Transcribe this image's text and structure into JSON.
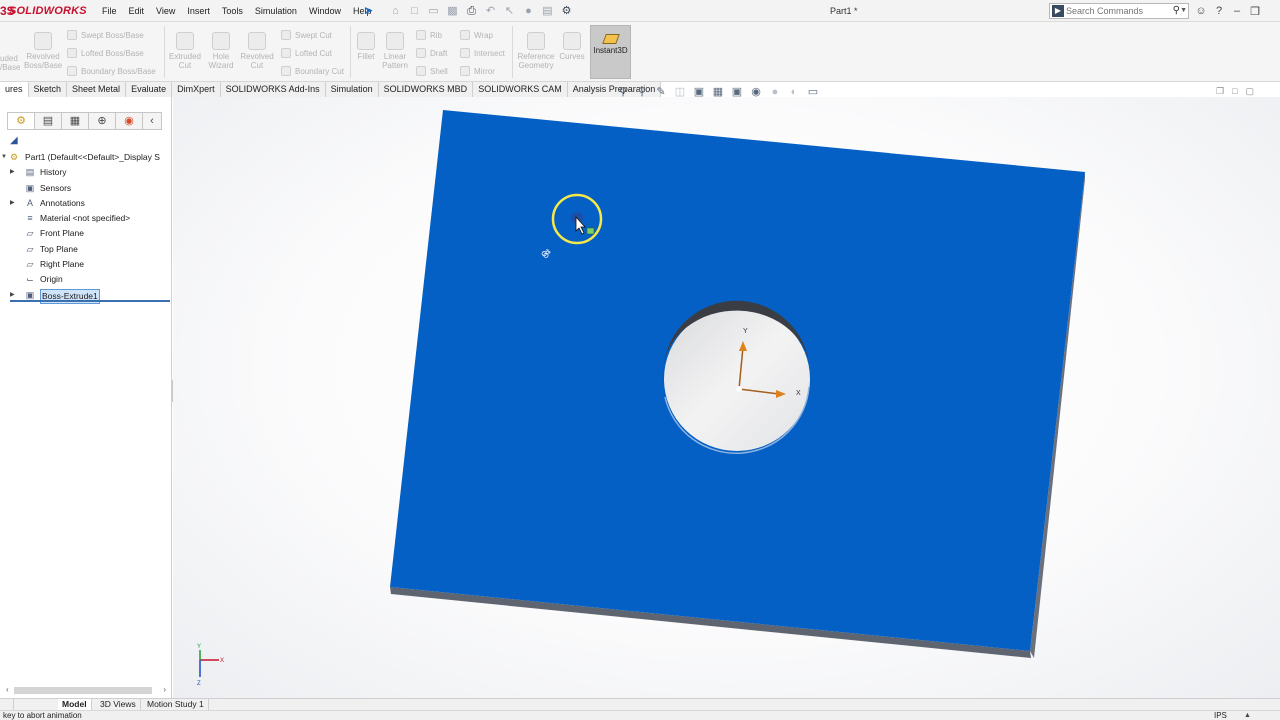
{
  "app": {
    "logo_mark": "3S",
    "logo_name": "SOLIDWORKS",
    "document_title": "Part1 *"
  },
  "menu": [
    "File",
    "Edit",
    "View",
    "Insert",
    "Tools",
    "Simulation",
    "Window",
    "Help"
  ],
  "search": {
    "placeholder": "Search Commands"
  },
  "ribbon": {
    "left_cut": [
      "uded",
      "/Base"
    ],
    "revolved_boss": "Revolved Boss/Base",
    "swept_boss": "Swept Boss/Base",
    "lofted_boss": "Lofted Boss/Base",
    "boundary_boss": "Boundary Boss/Base",
    "extruded_cut": "Extruded Cut",
    "hole_wizard": "Hole Wizard",
    "revolved_cut": "Revolved Cut",
    "swept_cut": "Swept Cut",
    "lofted_cut": "Lofted Cut",
    "boundary_cut": "Boundary Cut",
    "fillet": "Fillet",
    "linear_pattern": "Linear Pattern",
    "rib": "Rib",
    "draft": "Draft",
    "shell": "Shell",
    "wrap": "Wrap",
    "intersect": "Intersect",
    "mirror": "Mirror",
    "reference_geometry": "Reference Geometry",
    "curves": "Curves",
    "instant3d": "Instant3D"
  },
  "command_tabs": [
    "ures",
    "Sketch",
    "Sheet Metal",
    "Evaluate",
    "DimXpert",
    "SOLIDWORKS Add-Ins",
    "Simulation",
    "SOLIDWORKS MBD",
    "SOLIDWORKS CAM",
    "Analysis Preparation"
  ],
  "feature_tree": {
    "root": "Part1  (Default<<Default>_Display S",
    "items": [
      {
        "label": "History",
        "expandable": true,
        "icon": "history-icon"
      },
      {
        "label": "Sensors",
        "expandable": false,
        "icon": "sensors-icon"
      },
      {
        "label": "Annotations",
        "expandable": true,
        "icon": "annotations-icon"
      },
      {
        "label": "Material <not specified>",
        "expandable": false,
        "icon": "material-icon"
      },
      {
        "label": "Front Plane",
        "expandable": false,
        "icon": "plane-icon"
      },
      {
        "label": "Top Plane",
        "expandable": false,
        "icon": "plane-icon"
      },
      {
        "label": "Right Plane",
        "expandable": false,
        "icon": "plane-icon"
      },
      {
        "label": "Origin",
        "expandable": false,
        "icon": "origin-icon"
      },
      {
        "label": "Boss-Extrude1",
        "expandable": true,
        "icon": "boss-extrude-icon",
        "selected": true
      }
    ]
  },
  "viewport": {
    "part_color": "#0460c4",
    "axis_labels": {
      "x": "X",
      "y": "Y"
    },
    "triad": {
      "x": "X",
      "y": "Y",
      "z": "Z"
    }
  },
  "bottom_tabs": [
    "Model",
    "3D Views",
    "Motion Study 1"
  ],
  "status": {
    "message": "key to abort animation",
    "units": "IPS"
  },
  "colors": {
    "brand": "#c8102e",
    "selection": "#cfe4f9",
    "part": "#0460c4"
  }
}
